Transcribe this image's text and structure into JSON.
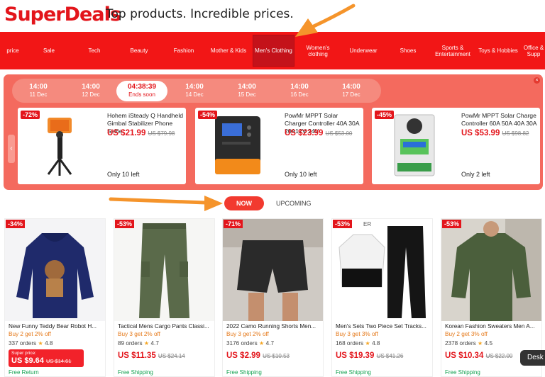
{
  "header": {
    "logo": "SuperDeals",
    "tagline": "Top products. Incredible prices."
  },
  "nav": {
    "items": [
      {
        "label": "price"
      },
      {
        "label": "Sale"
      },
      {
        "label": "Tech"
      },
      {
        "label": "Beauty"
      },
      {
        "label": "Fashion"
      },
      {
        "label": "Mother & Kids"
      },
      {
        "label": "Men's Clothing",
        "active": true
      },
      {
        "label": "Women's clothing"
      },
      {
        "label": "Underwear"
      },
      {
        "label": "Shoes"
      },
      {
        "label": "Sports & Entertainment"
      },
      {
        "label": "Toys & Hobbies"
      },
      {
        "label": "Office & Supp"
      }
    ]
  },
  "timeline": {
    "slots": [
      {
        "time": "14:00",
        "date": "11 Dec"
      },
      {
        "time": "14:00",
        "date": "12 Dec"
      },
      {
        "time": "04:38:39",
        "date": "Ends soon",
        "active": true
      },
      {
        "time": "14:00",
        "date": "14 Dec"
      },
      {
        "time": "14:00",
        "date": "15 Dec"
      },
      {
        "time": "14:00",
        "date": "16 Dec"
      },
      {
        "time": "14:00",
        "date": "17 Dec"
      }
    ]
  },
  "deals": [
    {
      "discount": "-72%",
      "title": "Hohem iSteady Q Handheld Gimbal Stabilizer Phone Selfie",
      "price": "US $21.99",
      "old_price": "US $79.98",
      "stock": "Only 10 left"
    },
    {
      "discount": "-54%",
      "title": "PowMr MPPT Solar Charger Controller 40A 30A 20A12V 24V",
      "price": "US $23.99",
      "old_price": "US $53.00",
      "stock": "Only 10 left"
    },
    {
      "discount": "-45%",
      "title": "PowMr MPPT Solar Charge Controller 60A 50A 40A 30A",
      "price": "US $53.99",
      "old_price": "US $98.82",
      "stock": "Only 2 left"
    }
  ],
  "tabs": {
    "now": "NOW",
    "upcoming": "UPCOMING"
  },
  "products": [
    {
      "discount": "-34%",
      "title": "New Funny Teddy Bear Robot H...",
      "promo": "Buy 2 get 2% off",
      "orders": "337 orders",
      "rating": "4.8",
      "super_label": "Super price:",
      "price": "US $9.64",
      "old_price": "US $14.61",
      "shipping": "Free Return"
    },
    {
      "discount": "-53%",
      "title": "Tactical Mens Cargo Pants Classi...",
      "promo": "Buy 3 get 2% off",
      "orders": "89 orders",
      "rating": "4.7",
      "price": "US $11.35",
      "old_price": "US $24.14",
      "shipping": "Free Shipping"
    },
    {
      "discount": "-71%",
      "title": "2022 Camo Running Shorts Men...",
      "promo": "Buy 3 get 2% off",
      "orders": "3176 orders",
      "rating": "4.7",
      "price": "US $2.99",
      "old_price": "US $10.53",
      "shipping": "Free Shipping"
    },
    {
      "discount": "-53%",
      "title": "Men's Sets Two Piece Set Tracks...",
      "promo": "Buy 3 get 3% off",
      "orders": "168 orders",
      "rating": "4.8",
      "price": "US $19.39",
      "old_price": "US $41.26",
      "shipping": "Free Shipping",
      "img_tag": "ER"
    },
    {
      "discount": "-53%",
      "title": "Korean Fashion Sweaters Men A...",
      "promo": "Buy 2 get 3% off",
      "orders": "2378 orders",
      "rating": "4.5",
      "price": "US $10.34",
      "old_price": "US $22.00",
      "shipping": "Free Shipping"
    }
  ],
  "desk_tip": "Desk",
  "icons": {
    "carousel_prev": "chevron-left-icon",
    "carousel_next": "chevron-right-icon",
    "star": "star-icon",
    "close": "close-icon"
  },
  "colors": {
    "brand_red": "#e3151b",
    "nav_red": "#f21616",
    "deals_panel": "#f46a5e",
    "promo_orange": "#e57818",
    "shipping_green": "#11a14f",
    "annotation_arrow": "#f5942b"
  }
}
